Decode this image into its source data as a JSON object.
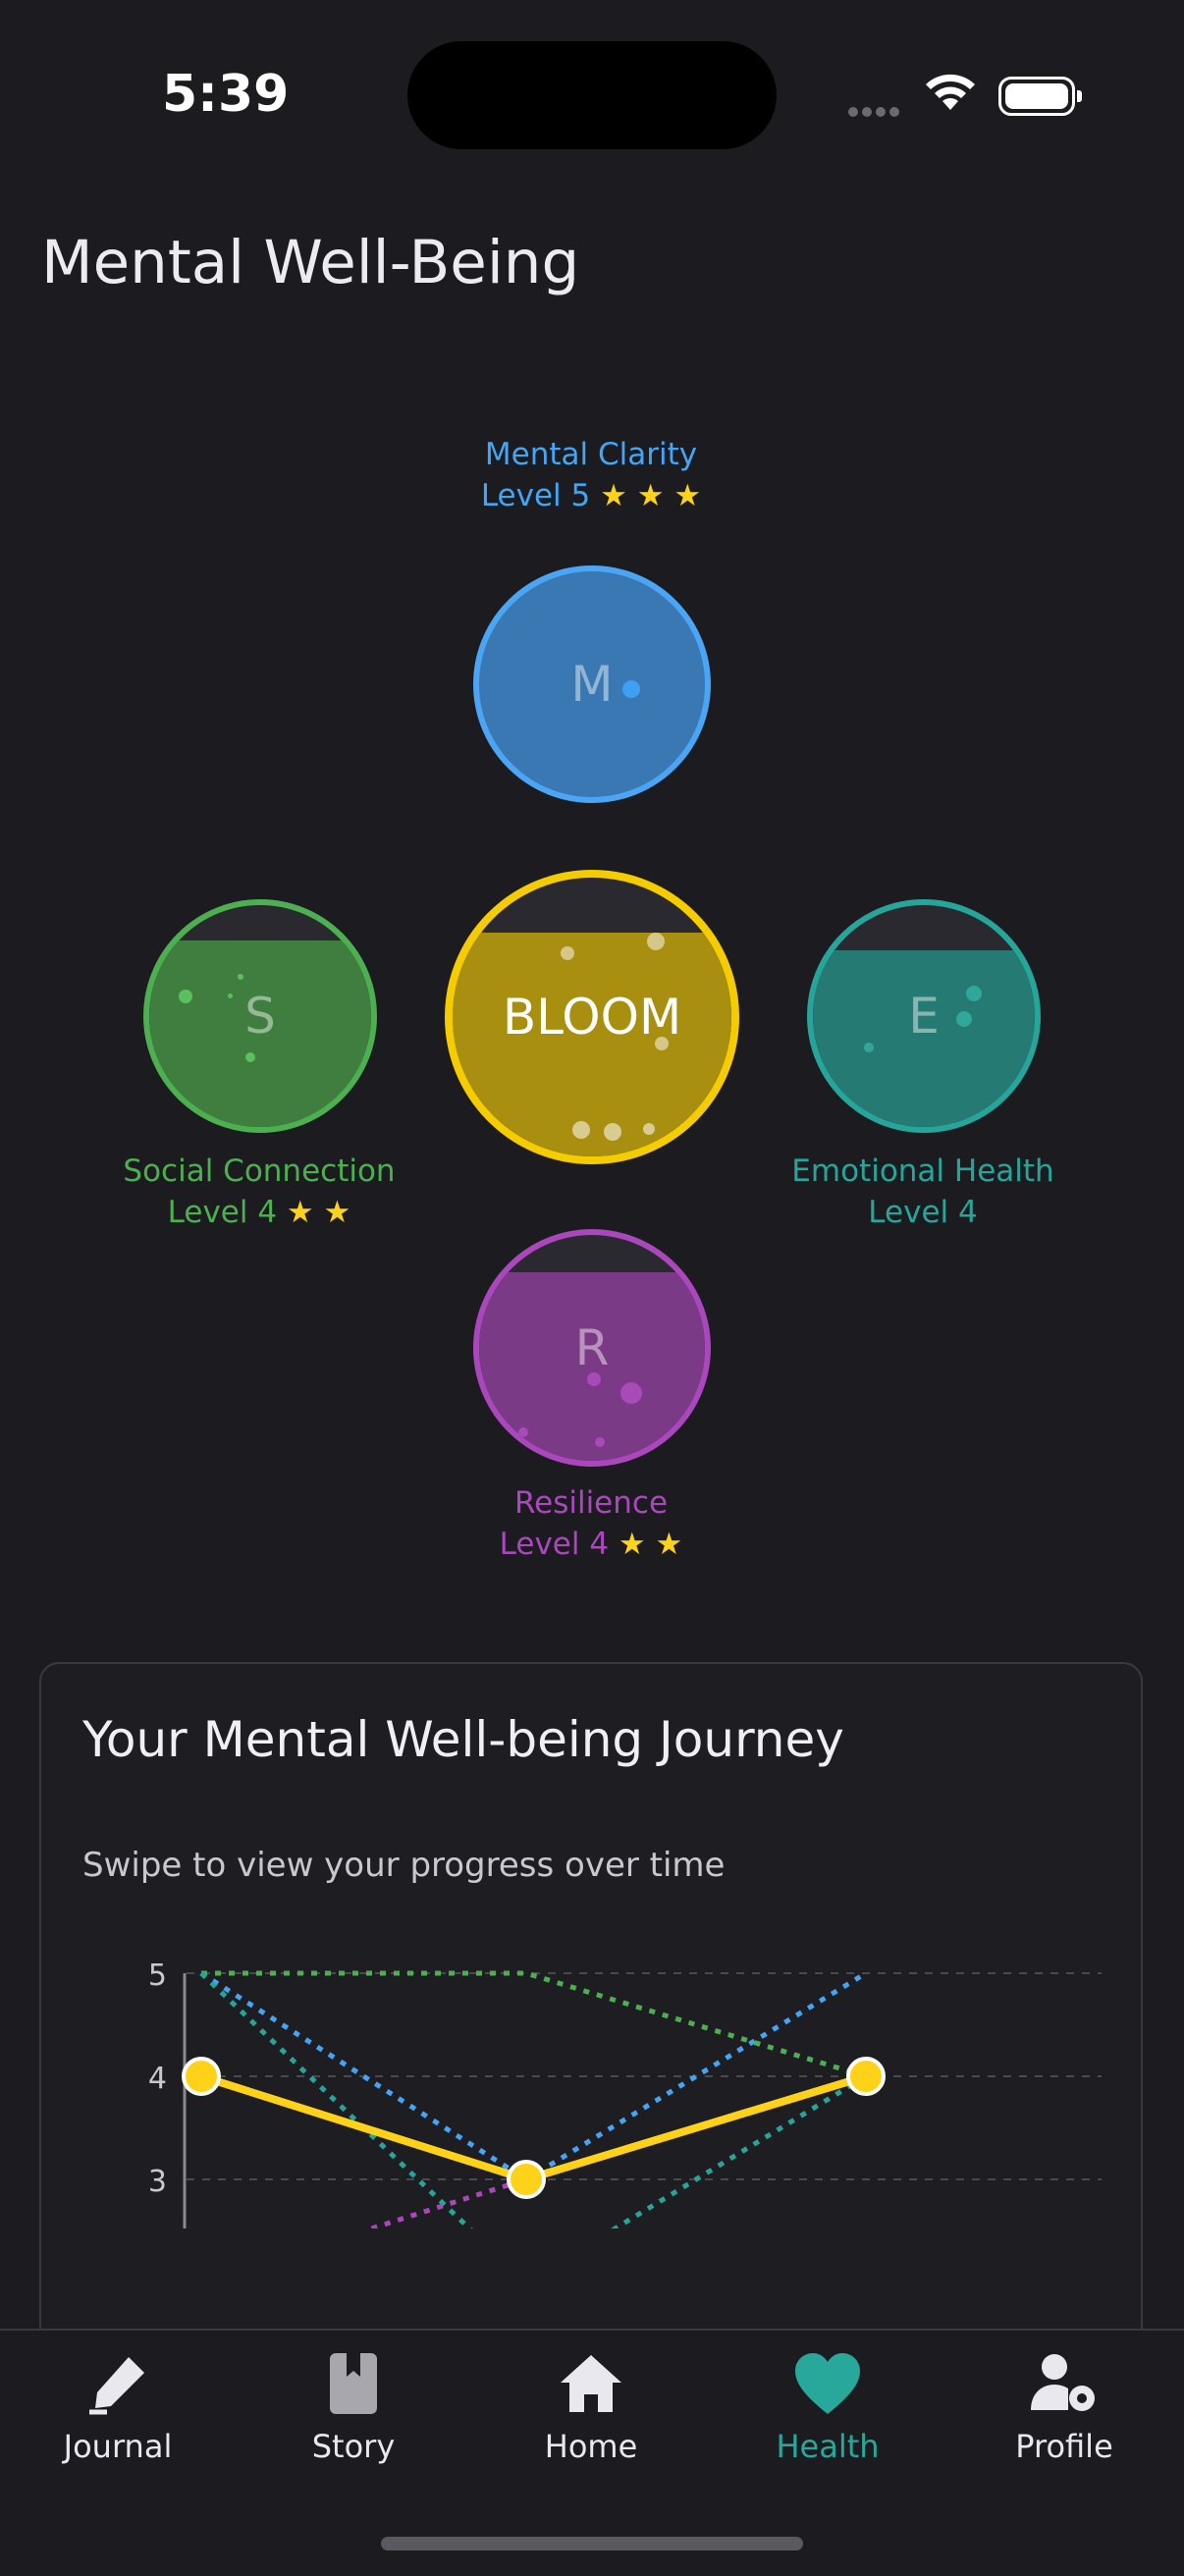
{
  "status_bar": {
    "time": "5:39"
  },
  "page": {
    "title": "Mental Well-Being"
  },
  "orbs": {
    "center": {
      "label": "BLOOM",
      "color": "#f5cc00",
      "fill": "#a88f10"
    },
    "mental": {
      "letter": "M",
      "name": "Mental Clarity",
      "level": "Level 5",
      "stars": "★ ★ ★",
      "color": "#42a5f5"
    },
    "social": {
      "letter": "S",
      "name": "Social Connection",
      "level": "Level 4",
      "stars": "★ ★",
      "color": "#4caf50"
    },
    "emotional": {
      "letter": "E",
      "name": "Emotional Health",
      "level": "Level 4",
      "stars": "",
      "color": "#26a69a"
    },
    "resilience": {
      "letter": "R",
      "name": "Resilience",
      "level": "Level 4",
      "stars": "★ ★",
      "color": "#ab47bc"
    }
  },
  "journey": {
    "title": "Your Mental Well-being Journey",
    "subtitle": "Swipe to view your progress over time"
  },
  "chart_data": {
    "type": "line",
    "x": [
      1,
      2,
      3
    ],
    "ylim": [
      2.5,
      5
    ],
    "yticks": [
      "5",
      "4",
      "3"
    ],
    "grid": true,
    "series": [
      {
        "values": [
          4,
          3,
          4
        ],
        "color": "#ffd21a",
        "style": "solid"
      },
      {
        "values": [
          5,
          3,
          5
        ],
        "color": "#42a5f5",
        "style": "dotted"
      },
      {
        "values": [
          5,
          5,
          4
        ],
        "color": "#4caf50",
        "style": "dotted"
      },
      {
        "values": [
          5,
          2,
          4
        ],
        "color": "#26a69a",
        "style": "dotted"
      },
      {
        "values": [
          2,
          3,
          4
        ],
        "color": "#ab47bc",
        "style": "dotted"
      }
    ]
  },
  "nav": {
    "items": [
      {
        "label": "Journal",
        "icon": "pencil-icon"
      },
      {
        "label": "Story",
        "icon": "bookmark-icon"
      },
      {
        "label": "Home",
        "icon": "home-icon"
      },
      {
        "label": "Health",
        "icon": "heart-icon"
      },
      {
        "label": "Profile",
        "icon": "user-settings-icon"
      }
    ],
    "active_color": "#27a89a"
  }
}
